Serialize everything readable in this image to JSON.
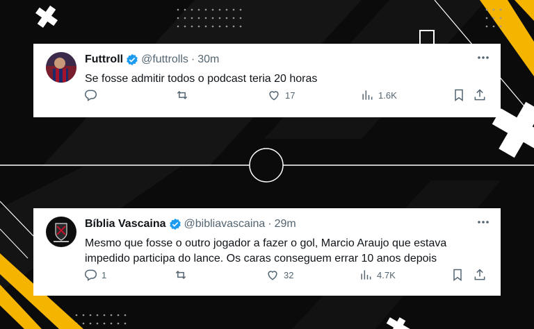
{
  "tweets": [
    {
      "name": "Futtroll",
      "handle": "@futtrolls",
      "separator": "·",
      "time": "30m",
      "text": "Se fosse admitir todos o podcast teria 20 horas",
      "replies": "",
      "retweets": "",
      "likes": "17",
      "views": "1.6K"
    },
    {
      "name": "Bíblia Vascaina",
      "handle": "@bibliavascaina",
      "separator": "·",
      "time": "29m",
      "text": "Mesmo que fosse o outro jogador a fazer o gol, Marcio Araujo que estava impedido participa do lance. Os caras conseguem errar 10 anos depois",
      "replies": "1",
      "retweets": "",
      "likes": "32",
      "views": "4.7K"
    }
  ],
  "colors": {
    "verified": "#1d9bf0",
    "accent_yellow": "#f5b400",
    "text_secondary": "#536471"
  }
}
